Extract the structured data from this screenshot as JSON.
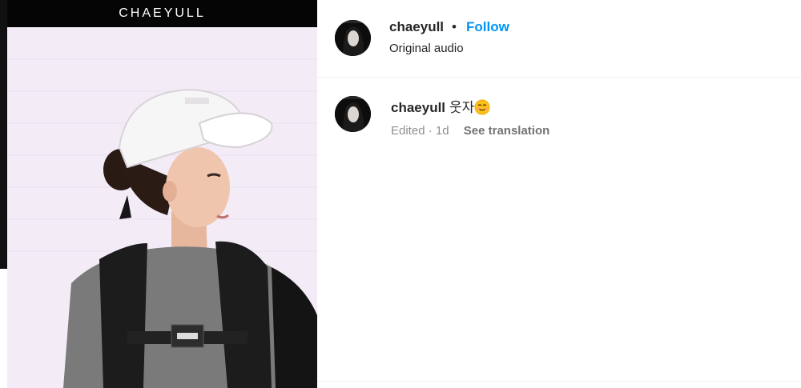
{
  "media": {
    "header_text": "CHAEYULL",
    "image_alt": "Young woman in white cap and gray t-shirt wearing black backpack straps"
  },
  "post_header": {
    "username": "chaeyull",
    "separator": "•",
    "follow_label": "Follow",
    "audio_label": "Original audio"
  },
  "comment": {
    "username": "chaeyull",
    "text": "웃자",
    "emoji": "smiling-face-emoji",
    "edited_label": "Edited",
    "meta_separator": "·",
    "time": "1d",
    "translate_label": "See translation"
  },
  "colors": {
    "follow_blue": "#0095f6",
    "text_primary": "#262626",
    "text_secondary": "#8e8e8e",
    "divider": "#efefef"
  }
}
